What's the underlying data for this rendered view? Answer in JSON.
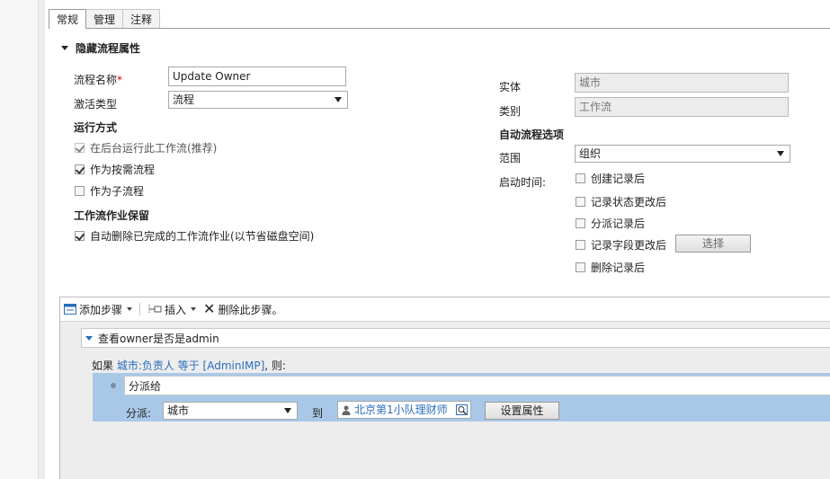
{
  "tabs": [
    {
      "label": "常规",
      "active": true
    },
    {
      "label": "管理",
      "active": false
    },
    {
      "label": "注释",
      "active": false
    }
  ],
  "section_title": "隐藏流程属性",
  "left": {
    "process_name_label": "流程名称",
    "required_mark": "*",
    "process_name_value": "Update Owner",
    "activation_type_label": "激活类型",
    "activation_type_value": "流程",
    "run_mode_heading": "运行方式",
    "run_background_label": "在后台运行此工作流(推荐)",
    "run_on_demand_label": "作为按需流程",
    "run_child_label": "作为子流程",
    "job_retention_heading": "工作流作业保留",
    "auto_delete_label": "自动删除已完成的工作流作业(以节省磁盘空间)"
  },
  "right": {
    "entity_label": "实体",
    "entity_value": "城市",
    "category_label": "类别",
    "category_value": "工作流",
    "auto_options_heading": "自动流程选项",
    "scope_label": "范围",
    "scope_value": "组织",
    "start_when_label": "启动时间:",
    "start_options": [
      "创建记录后",
      "记录状态更改后",
      "分派记录后",
      "记录字段更改后",
      "删除记录后"
    ],
    "select_button": "选择"
  },
  "toolbar": {
    "add_step": "添加步骤",
    "insert": "插入",
    "delete_step": "删除此步骤。"
  },
  "step": {
    "name": "查看owner是否是admin",
    "cond_prefix": "如果",
    "cond_link": "城市:负责人 等于 [AdminIMP]",
    "cond_suffix": ", 则:",
    "action_name": "分派给",
    "assign_label": "分派:",
    "assign_entity": "城市",
    "to_label": "到",
    "assignee": "北京第1小队理财师",
    "set_properties": "设置属性"
  },
  "colors": {
    "link": "#2a6ebd",
    "action_block": "#a9c8e8",
    "panel_bg": "#ededed"
  }
}
